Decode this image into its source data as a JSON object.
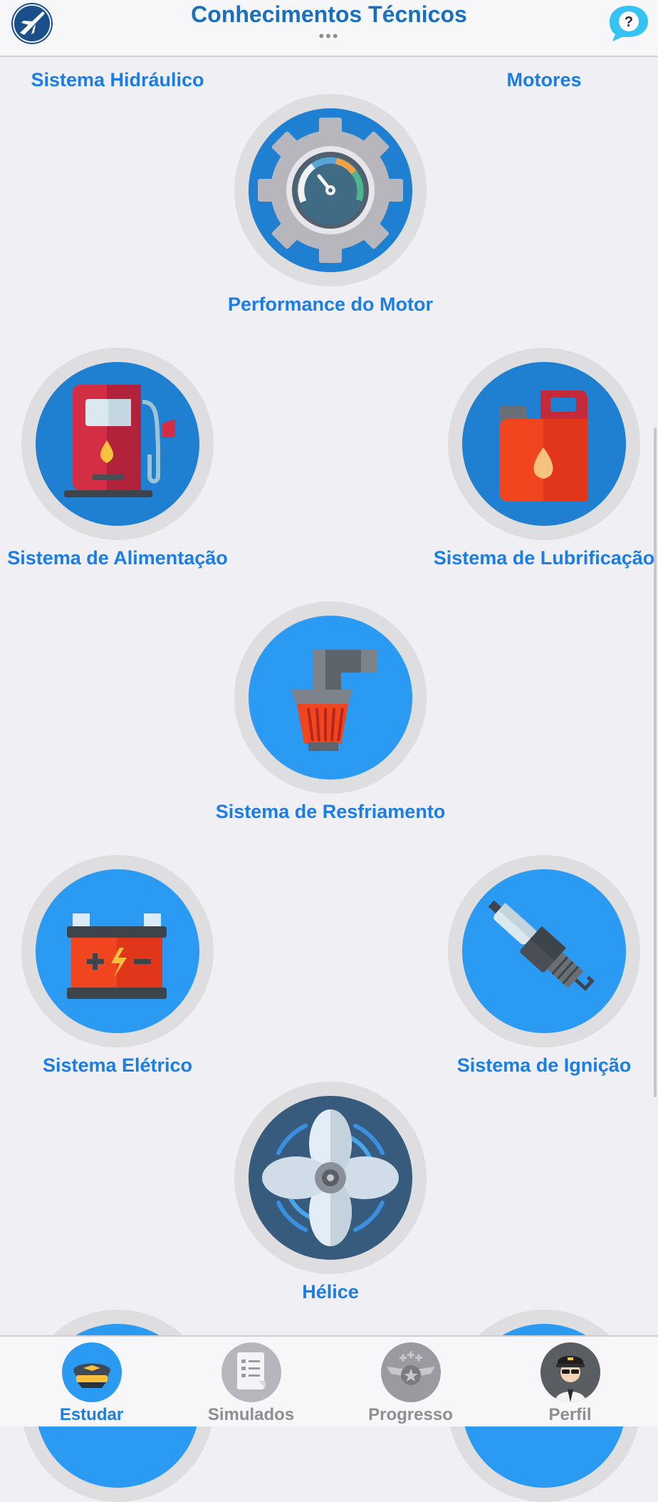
{
  "header": {
    "title": "Conhecimentos Técnicos",
    "more": "•••",
    "help": "?"
  },
  "topics": [
    {
      "label": "Sistema Hidráulico",
      "icon": "hydraulic-icon"
    },
    {
      "label": "Motores",
      "icon": "engine-icon"
    },
    {
      "label": "Performance do Motor",
      "icon": "gear-gauge-icon"
    },
    {
      "label": "Sistema de Alimentação",
      "icon": "fuel-pump-icon"
    },
    {
      "label": "Sistema de Lubrificação",
      "icon": "oil-can-icon"
    },
    {
      "label": "Sistema de Resfriamento",
      "icon": "cooling-filter-icon"
    },
    {
      "label": "Sistema Elétrico",
      "icon": "battery-icon"
    },
    {
      "label": "Sistema de Ignição",
      "icon": "spark-plug-icon"
    },
    {
      "label": "Hélice",
      "icon": "propeller-icon"
    }
  ],
  "tabs": [
    {
      "label": "Estudar",
      "icon": "pilot-cap-icon",
      "active": true
    },
    {
      "label": "Simulados",
      "icon": "exam-sheet-icon",
      "active": false
    },
    {
      "label": "Progresso",
      "icon": "wings-badge-icon",
      "active": false
    },
    {
      "label": "Perfil",
      "icon": "pilot-avatar-icon",
      "active": false
    }
  ],
  "colors": {
    "accent": "#1a7ee6",
    "title": "#1b6fbd",
    "disc_blue": "#2b9af3",
    "disc_dark_blue": "#1f7fd1",
    "disc_navy": "#365b7d",
    "inactive": "#8e8e93"
  }
}
